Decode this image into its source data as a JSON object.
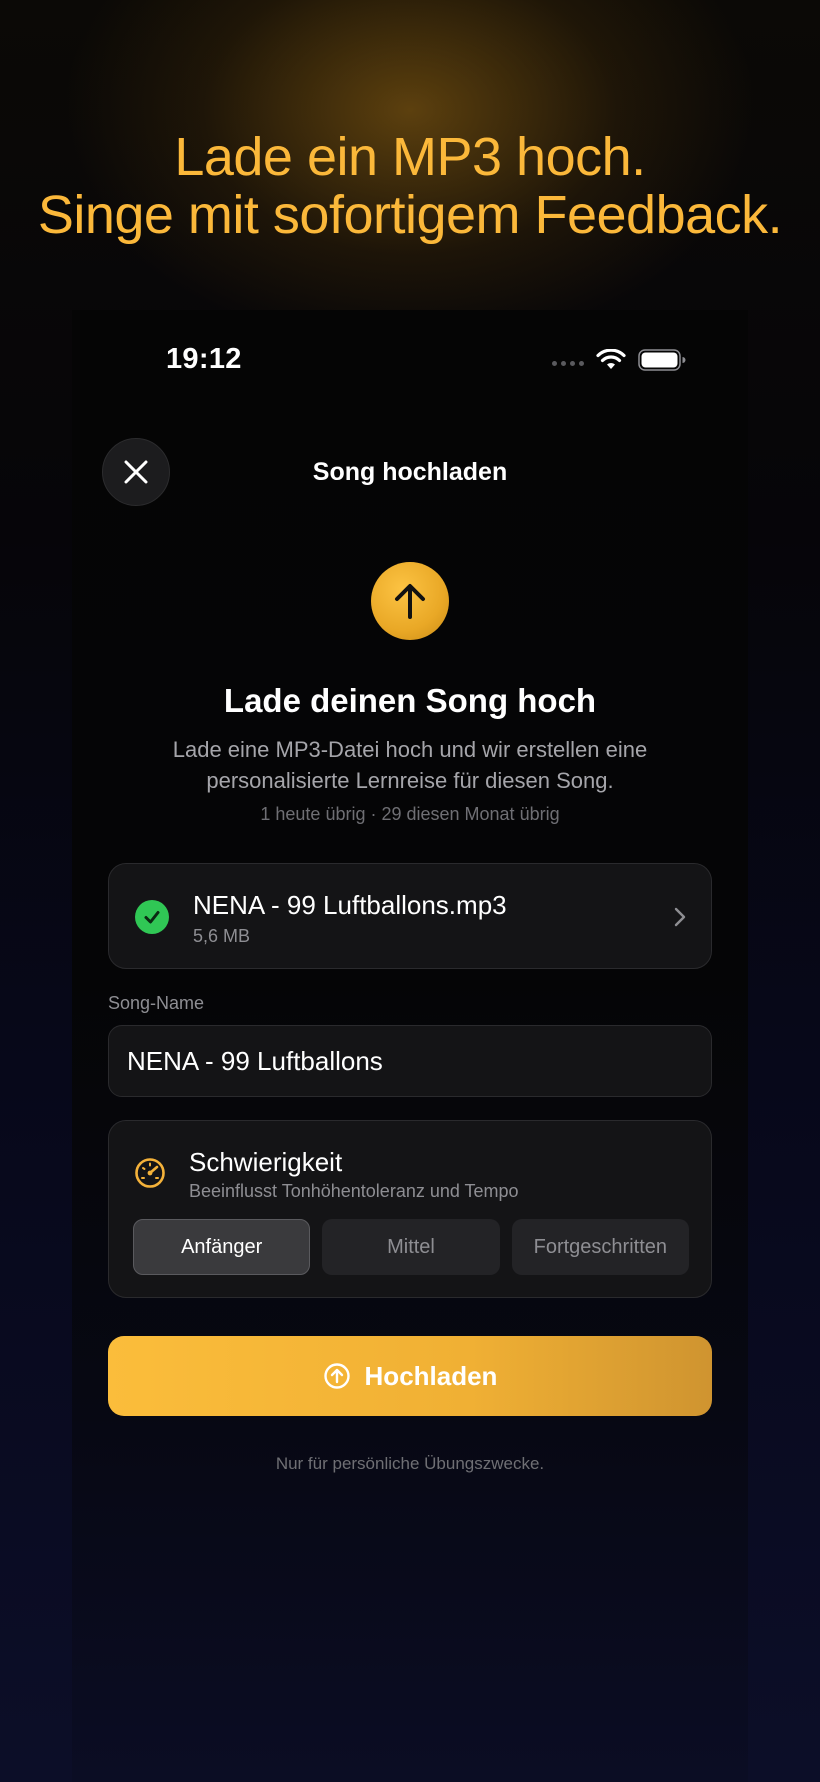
{
  "headline": {
    "line1": "Lade ein MP3 hoch.",
    "line2": "Singe mit sofortigem Feedback."
  },
  "status_bar": {
    "time": "19:12",
    "icons": [
      "signal-icon",
      "wifi-icon",
      "battery-icon"
    ]
  },
  "nav": {
    "title": "Song hochladen",
    "close_icon": "close-icon"
  },
  "hero": {
    "icon": "arrow-up-icon",
    "title": "Lade deinen Song hoch",
    "description": "Lade eine MP3-Datei hoch und wir erstellen eine personalisierte Lernreise für diesen Song.",
    "quota": "1 heute übrig · 29 diesen Monat übrig"
  },
  "file": {
    "name": "NENA - 99 Luftballons.mp3",
    "size": "5,6 MB",
    "status_icon": "check-circle-icon"
  },
  "song_name": {
    "label": "Song-Name",
    "value": "NENA - 99 Luftballons"
  },
  "difficulty": {
    "title": "Schwierigkeit",
    "subtitle": "Beeinflusst Tonhöhentoleranz und Tempo",
    "options": [
      "Anfänger",
      "Mittel",
      "Fortgeschritten"
    ],
    "selected": "Anfänger"
  },
  "upload_button": {
    "label": "Hochladen"
  },
  "footer": {
    "note": "Nur für persönliche Übungszwecke."
  },
  "colors": {
    "accent": "#FBB83A",
    "success": "#30C755",
    "card_bg": "#141416"
  }
}
